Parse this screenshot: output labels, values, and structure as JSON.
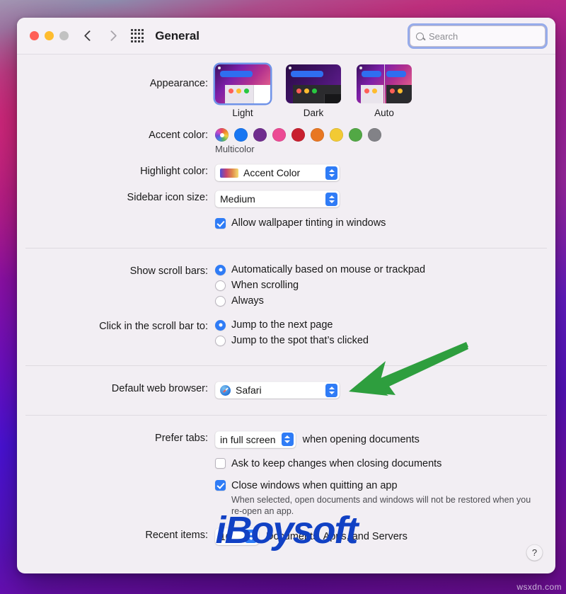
{
  "window": {
    "title": "General",
    "traffic_lights": [
      "close",
      "minimize",
      "zoom"
    ],
    "back_label": "Back",
    "forward_label": "Forward",
    "grid_label": "Show All",
    "search": {
      "placeholder": "Search",
      "value": ""
    }
  },
  "appearance": {
    "label": "Appearance:",
    "options": [
      {
        "name": "Light",
        "selected": true
      },
      {
        "name": "Dark",
        "selected": false
      },
      {
        "name": "Auto",
        "selected": false
      }
    ]
  },
  "accent": {
    "label": "Accent color:",
    "selected_name": "Multicolor",
    "swatches": [
      {
        "name": "Multicolor",
        "color": "multicolor"
      },
      {
        "name": "Blue",
        "color": "#1876f2"
      },
      {
        "name": "Purple",
        "color": "#702d8e"
      },
      {
        "name": "Pink",
        "color": "#ec4a94"
      },
      {
        "name": "Red",
        "color": "#c8202f"
      },
      {
        "name": "Orange",
        "color": "#e87722"
      },
      {
        "name": "Yellow",
        "color": "#f2ca34"
      },
      {
        "name": "Green",
        "color": "#52a845"
      },
      {
        "name": "Graphite",
        "color": "#828287"
      }
    ]
  },
  "highlight": {
    "label": "Highlight color:",
    "value": "Accent Color"
  },
  "sidebar_icon": {
    "label": "Sidebar icon size:",
    "value": "Medium"
  },
  "wallpaper_tinting": {
    "label": "Allow wallpaper tinting in windows",
    "checked": true
  },
  "scroll_bars": {
    "label": "Show scroll bars:",
    "options": [
      {
        "label": "Automatically based on mouse or trackpad",
        "selected": true
      },
      {
        "label": "When scrolling",
        "selected": false
      },
      {
        "label": "Always",
        "selected": false
      }
    ]
  },
  "scroll_click": {
    "label": "Click in the scroll bar to:",
    "options": [
      {
        "label": "Jump to the next page",
        "selected": true
      },
      {
        "label": "Jump to the spot that’s clicked",
        "selected": false
      }
    ]
  },
  "default_browser": {
    "label": "Default web browser:",
    "value": "Safari",
    "icon": "safari-icon"
  },
  "prefer_tabs": {
    "label": "Prefer tabs:",
    "value": "in full screen",
    "suffix": "when opening documents"
  },
  "ask_keep_changes": {
    "label": "Ask to keep changes when closing documents",
    "checked": false
  },
  "close_windows": {
    "label": "Close windows when quitting an app",
    "checked": true,
    "hint": "When selected, open documents and windows will not be restored when you re-open an app."
  },
  "recent_items": {
    "label": "Recent items:",
    "value": "10",
    "suffix": "Documents, Apps, and Servers"
  },
  "help": {
    "label": "?"
  },
  "annotation": {
    "arrow_color": "#2e9e3e",
    "arrow_target": "default-web-browser-popup"
  },
  "watermarks": {
    "brand": "iBoysoft",
    "site": "wsxdn.com"
  }
}
